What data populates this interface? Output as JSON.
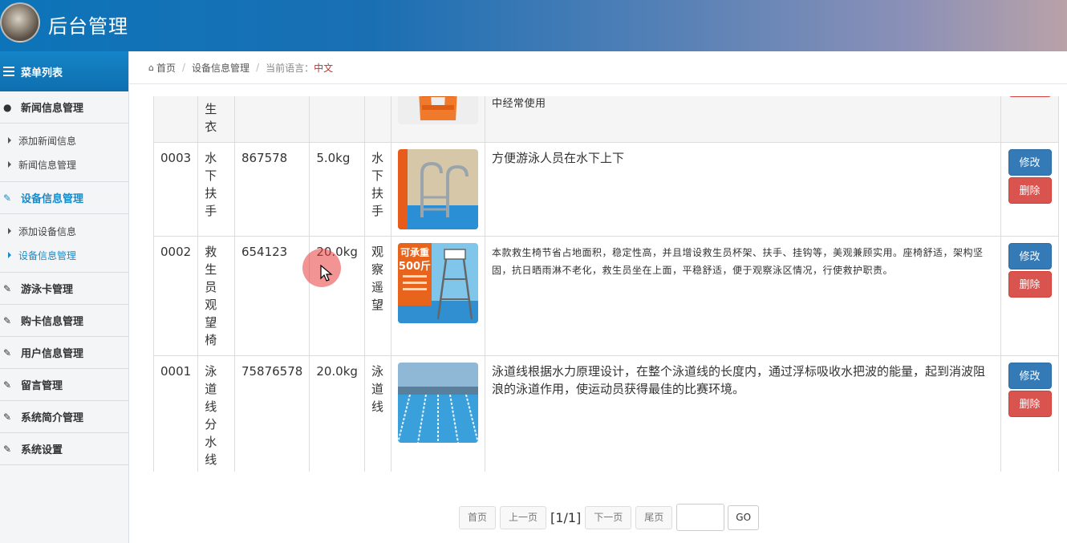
{
  "header": {
    "title": "后台管理",
    "avatar_icon": "cat-avatar"
  },
  "sidebar": {
    "menu_title": "菜单列表",
    "groups": [
      {
        "label": "新闻信息管理",
        "icon": "user-icon",
        "items": [
          "添加新闻信息",
          "新闻信息管理"
        ]
      },
      {
        "label": "设备信息管理",
        "icon": "edit-icon",
        "items": [
          "添加设备信息",
          "设备信息管理"
        ],
        "active_item": "设备信息管理"
      },
      {
        "label": "游泳卡管理",
        "icon": "edit-icon"
      },
      {
        "label": "购卡信息管理",
        "icon": "edit-icon"
      },
      {
        "label": "用户信息管理",
        "icon": "edit-icon"
      },
      {
        "label": "留言管理",
        "icon": "edit-icon"
      },
      {
        "label": "系统简介管理",
        "icon": "edit-icon"
      },
      {
        "label": "系统设置",
        "icon": "edit-icon"
      }
    ]
  },
  "breadcrumb": {
    "home": "首页",
    "current": "设备信息管理",
    "lang_label": "当前语言：",
    "lang_value": "中文"
  },
  "table": {
    "rows": [
      {
        "id": "",
        "name": "生衣",
        "code": "",
        "weight": "",
        "use": "",
        "desc": "中经常使用",
        "image": "life-jacket"
      },
      {
        "id": "0003",
        "name": "水下扶手",
        "code": "867578",
        "weight": "5.0kg",
        "use": "水下扶手",
        "desc": "方便游泳人员在水下上下",
        "image": "pool-ladder"
      },
      {
        "id": "0002",
        "name": "救生员观望椅",
        "code": "654123",
        "weight": "20.0kg",
        "use": "观察遥望",
        "desc": "本款救生椅节省占地面积，稳定性高，并且增设救生员杯架、扶手、挂钩等，美观兼顾实用。座椅舒适，架构坚固，抗日晒雨淋不老化，救生员坐在上面，平稳舒适，便于观察泳区情况，行使救护职责。",
        "image": "lifeguard-chair",
        "image_text": [
          "可承重",
          "500斤"
        ]
      },
      {
        "id": "0001",
        "name": "泳道线分水线",
        "code": "75876578",
        "weight": "20.0kg",
        "use": "泳道线",
        "desc": "泳道线根据水力原理设计，在整个泳道线的长度内，通过浮标吸收水把波的能量，起到消波阻浪的泳道作用，使运动员获得最佳的比赛环境。",
        "image": "swimming-lane"
      }
    ],
    "edit_label": "修改",
    "delete_label": "删除"
  },
  "pager": {
    "first": "首页",
    "prev": "上一页",
    "info": "[1/1]",
    "next": "下一页",
    "last": "尾页",
    "go": "GO",
    "input_value": ""
  },
  "colors": {
    "accent": "#1a8bc9",
    "edit": "#337ab7",
    "delete": "#d9534f",
    "lang": "#c9302c"
  }
}
